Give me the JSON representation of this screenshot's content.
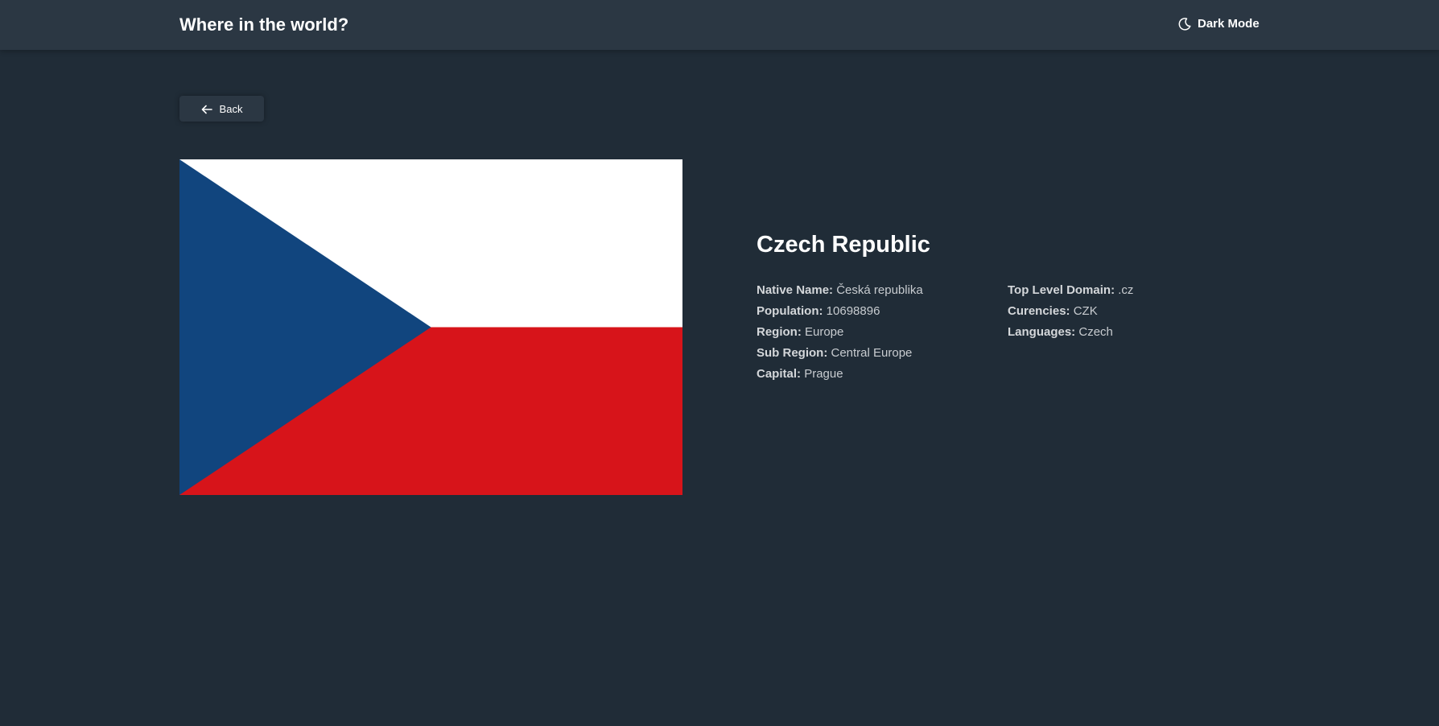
{
  "header": {
    "title": "Where in the world?",
    "mode_label": "Dark Mode",
    "mode_icon": "moon-icon"
  },
  "back_button": {
    "label": "Back",
    "icon": "arrow-left-icon"
  },
  "country": {
    "name": "Czech Republic",
    "flag": {
      "colors": {
        "white": "#ffffff",
        "red": "#d7141a",
        "blue": "#11457e"
      }
    },
    "details_left": [
      {
        "key": "Native Name:",
        "value": "Česká republika"
      },
      {
        "key": "Population:",
        "value": "10698896"
      },
      {
        "key": "Region:",
        "value": "Europe"
      },
      {
        "key": "Sub Region:",
        "value": "Central Europe"
      },
      {
        "key": "Capital:",
        "value": "Prague"
      }
    ],
    "details_right": [
      {
        "key": "Top Level Domain:",
        "value": ".cz"
      },
      {
        "key": "Curencies:",
        "value": "CZK"
      },
      {
        "key": "Languages:",
        "value": "Czech"
      }
    ]
  },
  "theme": {
    "background": "#202c37",
    "element": "#2b3743",
    "text": "#ffffff"
  }
}
